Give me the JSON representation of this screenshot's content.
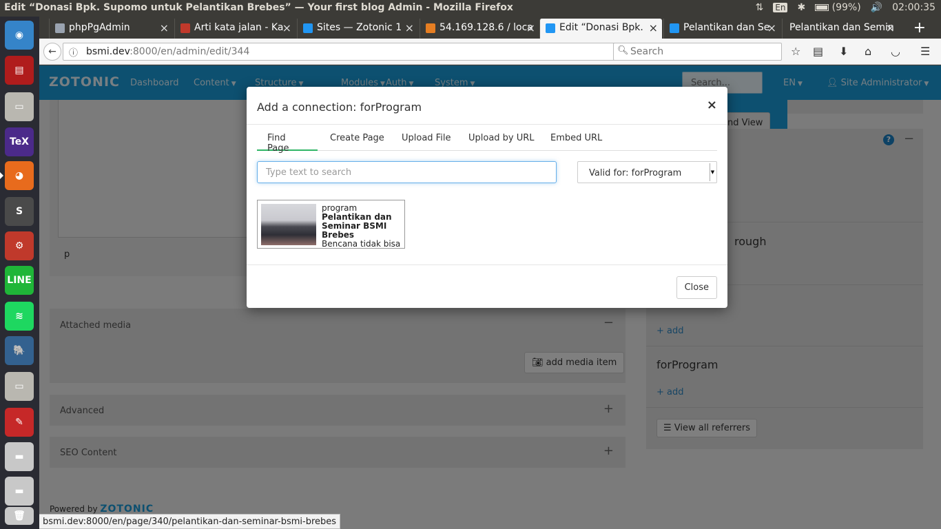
{
  "os": {
    "window_title": "Edit “Donasi Bpk. Supomo untuk Pelantikan Brebes” — Your first blog Admin - Mozilla Firefox",
    "keyboard": "En",
    "battery": "(99%)",
    "clock": "02:00:35"
  },
  "launcher": [
    {
      "icon": "ubuntu-dash-icon",
      "color": "#3584c9"
    },
    {
      "icon": "terminal-app-icon",
      "color": "#b01c1c"
    },
    {
      "icon": "file-cabinet-icon",
      "color": "#b9b7b0"
    },
    {
      "icon": "texmaker-icon",
      "color": "#4b2a8a"
    },
    {
      "icon": "firefox-icon",
      "color": "#e86b1d"
    },
    {
      "icon": "sublime-text-icon",
      "color": "#4a4a4a"
    },
    {
      "icon": "system-settings-icon",
      "color": "#c0392b"
    },
    {
      "icon": "line-app-icon",
      "color": "#1fb638"
    },
    {
      "icon": "spotify-icon",
      "color": "#1ed760"
    },
    {
      "icon": "postgresql-elephant-icon",
      "color": "#33618f"
    },
    {
      "icon": "file-cabinet-icon-2",
      "color": "#b9b7b0"
    },
    {
      "icon": "document-viewer-icon",
      "color": "#c62828"
    },
    {
      "icon": "drive-icon",
      "color": "#c8c8c8"
    },
    {
      "icon": "drive-icon-2",
      "color": "#c8c8c8"
    },
    {
      "icon": "trash-icon",
      "color": "#c8c8c8"
    }
  ],
  "tabs": [
    {
      "label": "phpPgAdmin",
      "color": "#9aa3b0"
    },
    {
      "label": "Arti kata jalan - Ka",
      "color": "#c0392b"
    },
    {
      "label": "Sites — Zotonic 1",
      "color": "#2196f3"
    },
    {
      "label": "54.169.128.6 / loca",
      "color": "#e67e22"
    },
    {
      "label": "Edit “Donasi Bpk.",
      "color": "#2196f3"
    },
    {
      "label": "Pelantikan dan Se",
      "color": "#2196f3"
    },
    {
      "label": "Pelantikan dan Semin",
      "color": ""
    }
  ],
  "address": {
    "host": "bsmi.dev",
    "path": ":8000/en/admin/edit/344"
  },
  "browser_search": {
    "placeholder": "Search"
  },
  "app": {
    "brand": "ZOTONIC",
    "menu": [
      "Dashboard",
      "Content",
      "Structure",
      "Modules",
      "Auth",
      "System"
    ],
    "search_placeholder": "Search...",
    "language": "EN",
    "user": "Site Administrator"
  },
  "background": {
    "p_label": "p",
    "save_view": "and View",
    "through_label": "rough",
    "attached_media": "Attached media",
    "add_media_item": "add media item",
    "advanced": "Advanced",
    "seo_content": "SEO Content",
    "add1": "+ add",
    "for_program": "forProgram",
    "add2": "+ add",
    "view_referrers": "View all referrers",
    "powered_by": "Powered by",
    "powered_brand": "ZOTONIC"
  },
  "modal": {
    "title": "Add a connection: forProgram",
    "tabs": [
      "Find Page",
      "Create Page",
      "Upload File",
      "Upload by URL",
      "Embed URL"
    ],
    "search_placeholder": "Type text to search",
    "select_value": "Valid for: forProgram",
    "result": {
      "category": "program",
      "title": "Pelantikan dan Seminar BSMI Brebes",
      "summary": "Bencana tidak bisa dihambat atau"
    },
    "close_label": "Close"
  },
  "statusbar": "bsmi.dev:8000/en/page/340/pelantikan-dan-seminar-bsmi-brebes"
}
